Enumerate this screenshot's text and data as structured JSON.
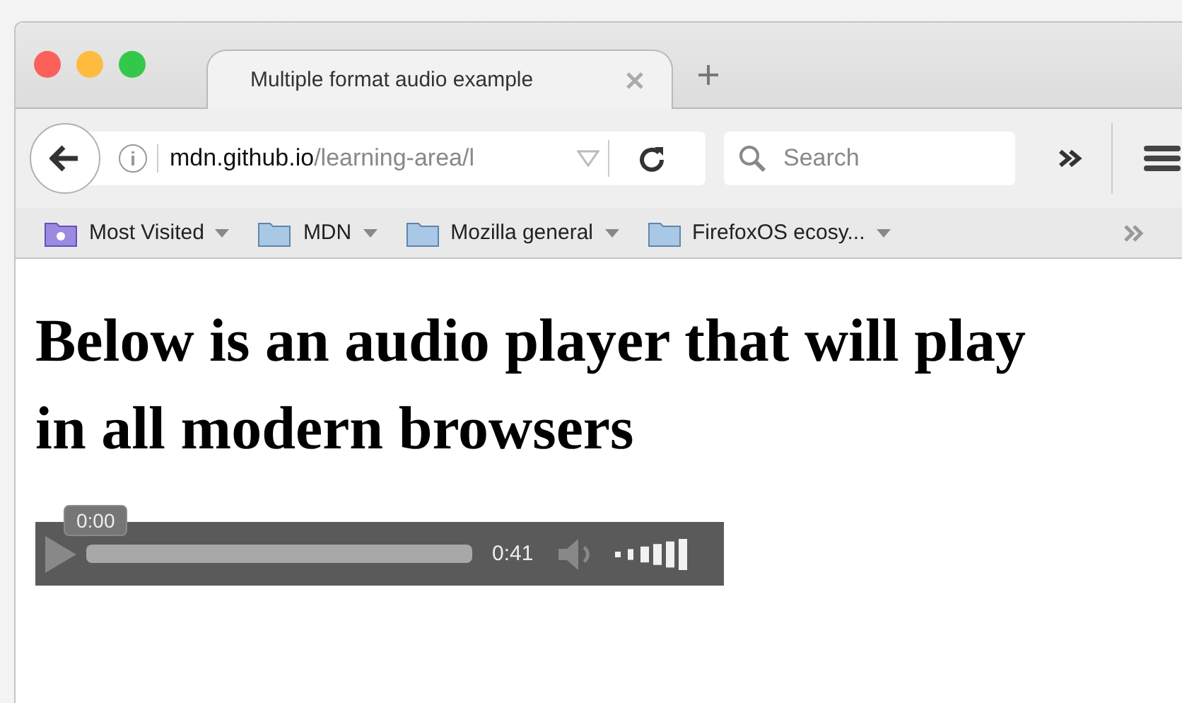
{
  "tab": {
    "title": "Multiple format audio example",
    "selected": true
  },
  "address": {
    "host": "mdn.github.io",
    "path": "/learning-area/l"
  },
  "search": {
    "placeholder": "Search"
  },
  "bookmarks": [
    {
      "label": "Most Visited",
      "kind": "smart"
    },
    {
      "label": "MDN",
      "kind": "folder"
    },
    {
      "label": "Mozilla general",
      "kind": "folder"
    },
    {
      "label": "FirefoxOS ecosy...",
      "kind": "folder"
    }
  ],
  "heading": "Below is an audio player that will play in all modern browsers",
  "player": {
    "tooltip": "0:00",
    "duration": "0:41",
    "volume": {
      "level": 1
    }
  }
}
